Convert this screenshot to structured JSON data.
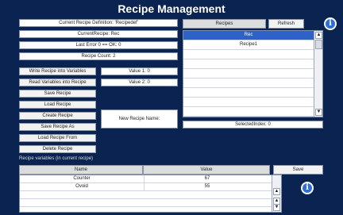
{
  "title": "Recipe Management",
  "status": {
    "current_def": "Current Recipe Definition: 'Recipedef'",
    "current_recipe": "CurrentRecipe: Rec",
    "last_error": "Last Error 0 == OK: 0",
    "recipe_count": "Recipe Count: 2"
  },
  "actions": [
    "Write Recipe into Variables",
    "Read Variables into Recipe",
    "Save Recipe",
    "Load Recipe",
    "Create Recipe",
    "Save Recipe As",
    "Load Recipe From",
    "Delete Recipe"
  ],
  "values": {
    "value1": "Value 1: 0",
    "value2": "Value 2: 0"
  },
  "new_recipe_label": "New Recipe Name:",
  "recipes_panel": {
    "header": "Recipes",
    "refresh_label": "Refresh",
    "items": [
      "Rec",
      "Recipe1"
    ],
    "selected_index_label": "SelectedIndex: 0"
  },
  "variables_caption": "Recipe variables (in current recipe)",
  "table": {
    "headers": [
      "Name",
      "Value"
    ],
    "save_label": "Save",
    "rows": [
      {
        "name": "Counter",
        "value": "67"
      },
      {
        "name": "Ovoid",
        "value": "55"
      }
    ]
  },
  "icons": {
    "info": "info-icon",
    "scroll_up": "scroll-up-arrow-icon",
    "scroll_down": "scroll-down-arrow-icon"
  },
  "colors": {
    "background": "#0b2350",
    "selection": "#2f62c8"
  }
}
